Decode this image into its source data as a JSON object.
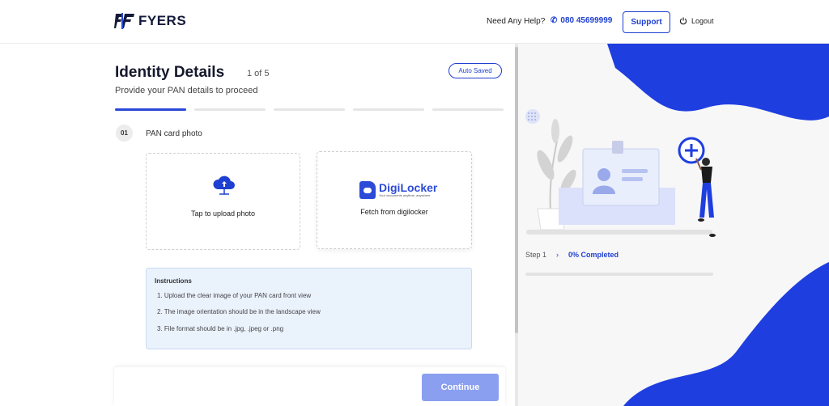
{
  "header": {
    "logo_text": "FYERS",
    "help_text": "Need Any Help?",
    "phone": "080 45699999",
    "support_label": "Support",
    "logout_label": "Logout"
  },
  "main": {
    "title": "Identity Details",
    "step_count": "1 of 5",
    "subtitle": "Provide your PAN details to proceed",
    "auto_saved": "Auto Saved",
    "progress_steps": 5,
    "active_step": 1,
    "step_number": "01",
    "step_label": "PAN card photo",
    "upload_label": "Tap to upload photo",
    "digilocker": {
      "brand": "DigiLocker",
      "tagline": "Your documents anytime, anywhere",
      "label": "Fetch from digilocker"
    },
    "instructions": {
      "title": "Instructions",
      "items": [
        "1. Upload the clear image of your PAN card front view",
        "2. The image orientation should be in the landscape view",
        "3. File format should be in .jpg, .jpeg or .png"
      ]
    },
    "continue_label": "Continue"
  },
  "sidebar": {
    "step_text": "Step 1",
    "completion_text": "0% Completed",
    "completion_value": 0
  },
  "colors": {
    "accent": "#1e3fd1",
    "blob": "#1f3ee0",
    "continue_disabled": "#8b9ff0"
  }
}
